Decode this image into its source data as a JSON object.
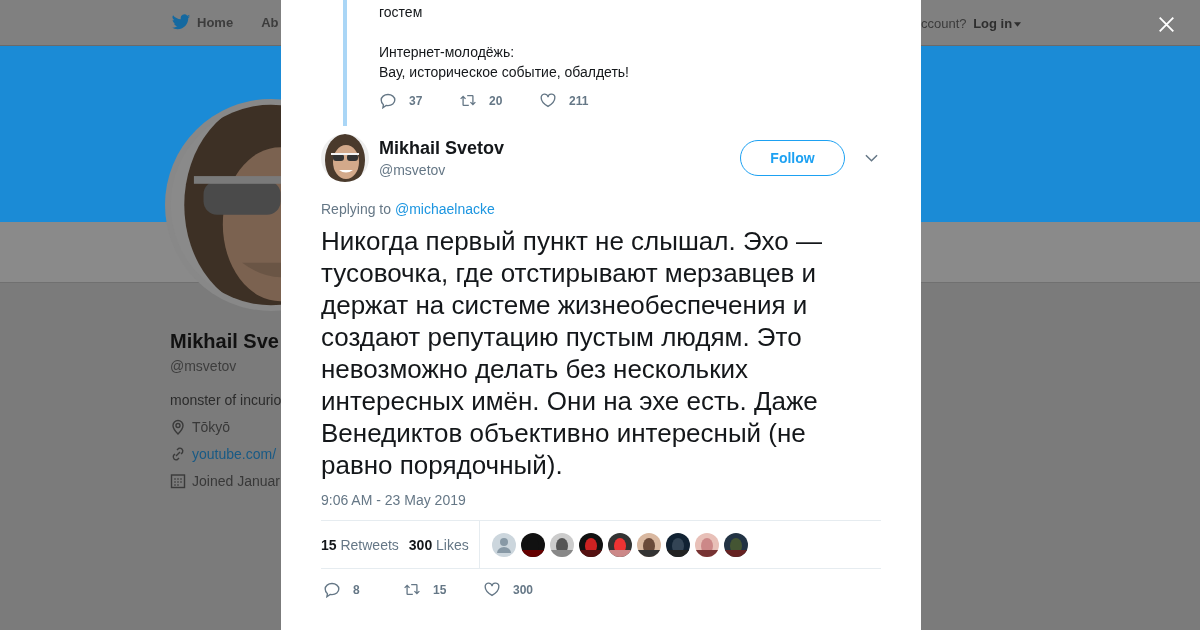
{
  "background_page": {
    "nav": {
      "items": [
        {
          "kind": "home",
          "label": "Home"
        },
        {
          "kind": "plain",
          "label": "Ab"
        }
      ],
      "login_prompt": "ccount?",
      "login_label": "Log in"
    },
    "profile": {
      "name": "Mikhail Sve",
      "handle": "@msvetov",
      "bio": "monster of incurio",
      "location": "Tōkyō",
      "link": "youtube.com/",
      "joined": "Joined Januar"
    }
  },
  "thread_tweet": {
    "paragraphs": [
      [
        "гостем"
      ],
      [
        "Интернет-молодёжь:",
        "Вау, историческое событие, обалдеть!"
      ]
    ],
    "actions": [
      {
        "kind": "reply",
        "count": "37"
      },
      {
        "kind": "retweet",
        "count": "20"
      },
      {
        "kind": "like",
        "count": "211"
      }
    ]
  },
  "tweet": {
    "author": {
      "name": "Mikhail Svetov",
      "handle": "@msvetov"
    },
    "follow_label": "Follow",
    "replying_label": "Replying to",
    "replying_handle": "@michaelnacke",
    "text": "Никогда первый пункт не слышал. Эхо — тусовочка, где отстирывают мерзавцев и держат на системе жизнеобеспечения и создают репутацию пустым людям. Это невозможно делать без нескольких интересных имён. Они на эхе есть. Даже Венедиктов объективно интересный (не равно порядочный).",
    "timestamp": "9:06 AM - 23 May 2019",
    "stats": [
      {
        "count": "15",
        "label": "Retweets"
      },
      {
        "count": "300",
        "label": "Likes"
      }
    ],
    "likers": [
      {
        "kind": "default"
      },
      {
        "kind": "picture"
      },
      {
        "kind": "picture"
      },
      {
        "kind": "picture"
      },
      {
        "kind": "picture"
      },
      {
        "kind": "picture"
      },
      {
        "kind": "picture"
      },
      {
        "kind": "picture"
      },
      {
        "kind": "picture"
      }
    ],
    "actions": [
      {
        "kind": "reply",
        "count": "8"
      },
      {
        "kind": "retweet",
        "count": "15"
      },
      {
        "kind": "like",
        "count": "300"
      }
    ]
  }
}
